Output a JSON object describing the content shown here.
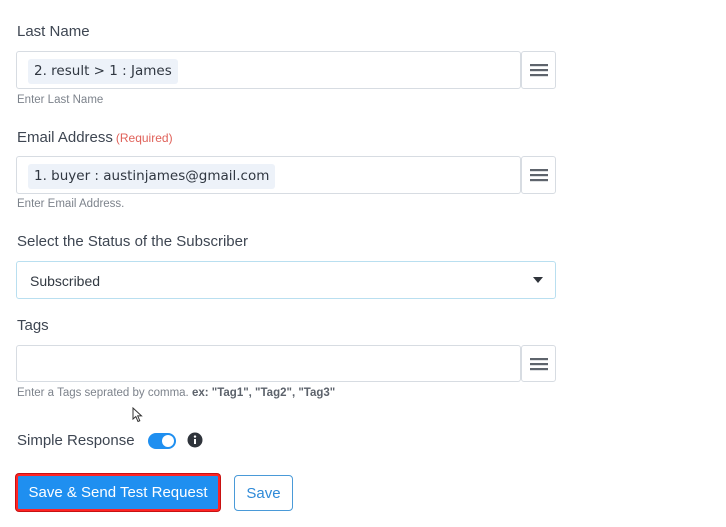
{
  "last_name": {
    "label": "Last Name",
    "chip": "2. result > 1 : James",
    "hint": "Enter Last Name"
  },
  "email": {
    "label": "Email Address",
    "required": "(Required)",
    "chip": "1. buyer : austinjames@gmail.com",
    "hint": "Enter Email Address."
  },
  "status": {
    "label": "Select the Status of the Subscriber",
    "selected": "Subscribed"
  },
  "tags": {
    "label": "Tags",
    "hint_prefix": "Enter a Tags seprated by comma.",
    "hint_example": "ex: \"Tag1\", \"Tag2\", \"Tag3\"",
    "value": ""
  },
  "simple_response": {
    "label": "Simple Response",
    "enabled": true
  },
  "actions": {
    "save_send_label": "Save & Send Test Request",
    "save_label": "Save"
  },
  "colors": {
    "accent": "#1f8ff0",
    "required": "#e0625a",
    "highlight_border": "#ff2424"
  },
  "icons": [
    "menu-icon",
    "caret-down-icon",
    "info-icon",
    "cursor-icon"
  ]
}
